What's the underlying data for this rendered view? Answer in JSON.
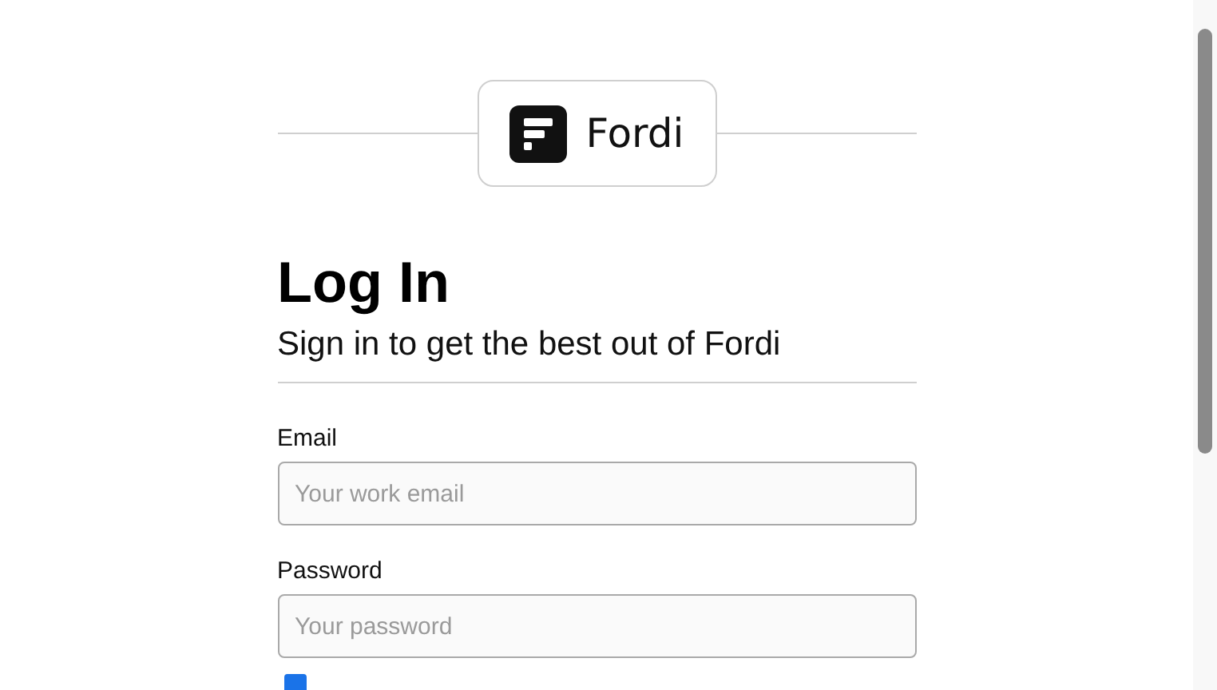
{
  "logo": {
    "name": "Fordi"
  },
  "heading": "Log In",
  "subheading": "Sign in to get the best out of Fordi",
  "fields": [
    {
      "label": "Email",
      "placeholder": "Your work email"
    },
    {
      "label": "Password",
      "placeholder": "Your password"
    }
  ],
  "remember": {
    "checked": true
  }
}
